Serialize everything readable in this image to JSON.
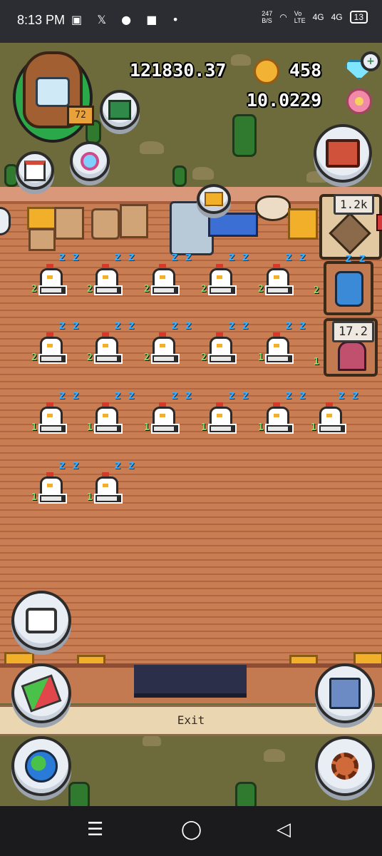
{
  "status_bar": {
    "time": "8:13 PM",
    "left_icons": "▣ 𝕏 ● ■ •",
    "net_speed": "247\nB/S",
    "volte": "Vo\nLTE",
    "signal1": "4G",
    "signal2": "4G",
    "battery": "13"
  },
  "hud": {
    "coins": "121830.37",
    "gems": "458",
    "flowers": "10.0229",
    "player_level": "72"
  },
  "tags": {
    "upgrade_price": "1.2k",
    "timer_value": "17.2"
  },
  "chickens": {
    "rows": [
      {
        "levels": [
          "2",
          "2",
          "2",
          "2",
          "2"
        ]
      },
      {
        "levels": [
          "2",
          "2",
          "2",
          "2",
          "1"
        ]
      },
      {
        "levels": [
          "1",
          "1",
          "1",
          "1",
          "1",
          "1"
        ]
      },
      {
        "levels": [
          "1",
          "1"
        ]
      }
    ]
  },
  "partial_levels": [
    "2",
    "1"
  ],
  "sleep_glyph": "z z",
  "exit_label": "Exit",
  "nav": {
    "menu": "☰",
    "home": "◯",
    "back": "◁"
  },
  "icons": {
    "chat": "chat-icon",
    "switch": "swap-arrows-icon",
    "world": "globe-icon",
    "save": "floppy-disk-icon",
    "settings": "gear-icon",
    "shop": "toolbox-icon",
    "calendar": "calendar-icon",
    "search": "magnifier-icon",
    "book": "book-clock-icon"
  },
  "colors": {
    "grass": "#6d6a3c",
    "floor": "#c97d52",
    "coin": "#f2b234",
    "gem": "#7fe6ff"
  }
}
